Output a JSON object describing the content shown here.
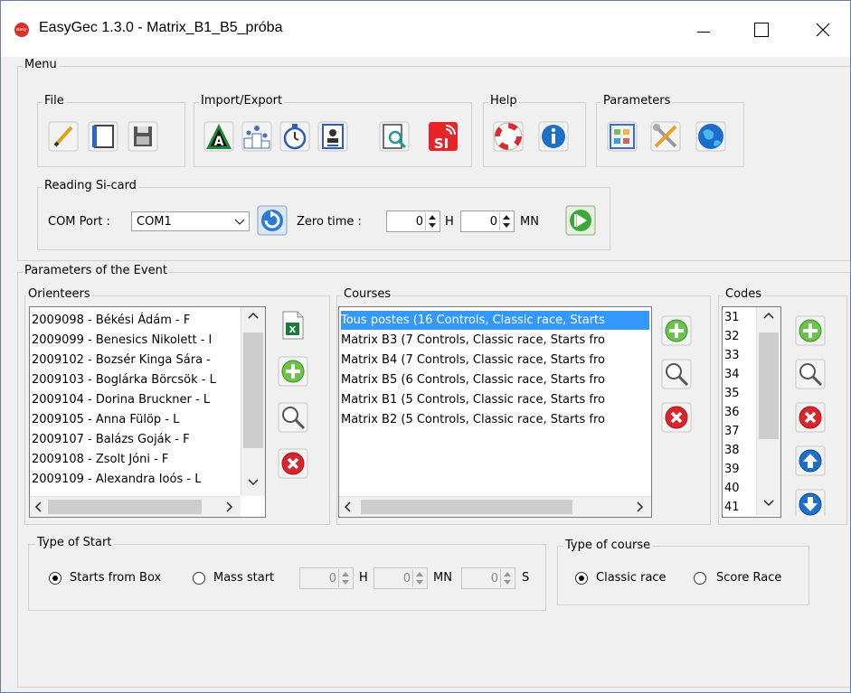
{
  "window": {
    "title": "EasyGec 1.3.0 - Matrix_B1_B5_próba",
    "icon_text": "easy"
  },
  "menu": {
    "label": "Menu",
    "file": {
      "label": "File",
      "icons": [
        "pencil-icon",
        "notebook-icon",
        "floppy-disk-icon"
      ]
    },
    "import_export": {
      "label": "Import/Export",
      "icons": [
        "a-logo-icon",
        "podium-icon",
        "stopwatch-icon",
        "id-card-icon",
        "document-search-icon",
        "si-logo-icon"
      ]
    },
    "help": {
      "label": "Help",
      "icons": [
        "lifebuoy-icon",
        "info-icon"
      ]
    },
    "parameters": {
      "label": "Parameters",
      "icons": [
        "window-layout-icon",
        "tools-icon",
        "globe-icon"
      ]
    },
    "reading": {
      "label": "Reading Si-card",
      "com_port_label": "COM Port :",
      "com_port_value": "COM1",
      "zero_time_label": "Zero time :",
      "hours": "0",
      "hours_unit": "H",
      "minutes": "0",
      "minutes_unit": "MN"
    }
  },
  "event": {
    "label": "Parameters of the Event",
    "orienteers": {
      "label": "Orienteers",
      "items": [
        "2009098 - Békési Ádám  - F",
        "2009099 -  Benesics Nikolett - I",
        "2009102 -  Bozsér Kinga Sára -",
        "2009103 - Boglárka Börcsök - L",
        "2009104 - Dorina Bruckner - L",
        "2009105 - Anna Fülöp - L",
        "2009107 - Balázs Goják - F",
        "2009108 - Zsolt Jóni - F",
        "2009109 - Alexandra Joós - L"
      ]
    },
    "courses": {
      "label": "Courses",
      "selected_index": 0,
      "items": [
        "Tous postes (16 Controls, Classic race, Starts",
        "Matrix B3 (7 Controls, Classic race, Starts fro",
        "Matrix B4 (7 Controls, Classic race, Starts fro",
        "Matrix B5 (6 Controls, Classic race, Starts fro",
        "Matrix B1 (5 Controls, Classic race, Starts fro",
        "Matrix B2 (5 Controls, Classic race, Starts fro"
      ]
    },
    "codes": {
      "label": "Codes",
      "items": [
        "31",
        "32",
        "33",
        "34",
        "35",
        "36",
        "37",
        "38",
        "39",
        "40",
        "41"
      ]
    },
    "start": {
      "label": "Type of Start",
      "box_label": "Starts from Box",
      "mass_label": "Mass start",
      "selected": "box",
      "h": "0",
      "h_unit": "H",
      "mn": "0",
      "mn_unit": "MN",
      "s": "0",
      "s_unit": "S"
    },
    "course_type": {
      "label": "Type of course",
      "classic_label": "Classic race",
      "score_label": "Score Race",
      "selected": "classic"
    }
  },
  "colors": {
    "accent": "#3399ff",
    "green": "#4caf2a",
    "red": "#d8242a",
    "blue": "#1f6fc9"
  }
}
